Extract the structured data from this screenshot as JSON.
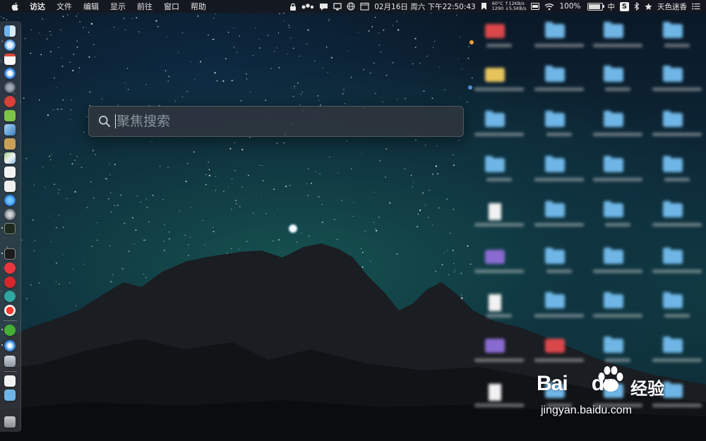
{
  "menubar": {
    "app_name": "访达",
    "menus": [
      "文件",
      "编辑",
      "显示",
      "前往",
      "窗口",
      "帮助"
    ],
    "temperature": "60°C",
    "fan_rpm": "1290",
    "net_up": "↑12KB/s",
    "net_down": "↓5.5KB/s",
    "datetime": "02月16日 周六 下午22:50:43",
    "battery": "100%",
    "input_method": "中",
    "user_name": "天色迷香"
  },
  "spotlight": {
    "placeholder": "聚焦搜索"
  },
  "watermark": {
    "brand": "Bai",
    "brand_suffix": "du",
    "product": "经验",
    "url": "jingyan.baidu.com"
  },
  "icons": {
    "apple": "apple-logo-icon",
    "search": "magnifier-icon",
    "wifi": "wifi-icon",
    "bluetooth": "bluetooth-icon"
  },
  "colors": {
    "menubar_bg": "#16181e",
    "spotlight_bg": "#30363e",
    "folder_blue": "#6fb6e6"
  }
}
